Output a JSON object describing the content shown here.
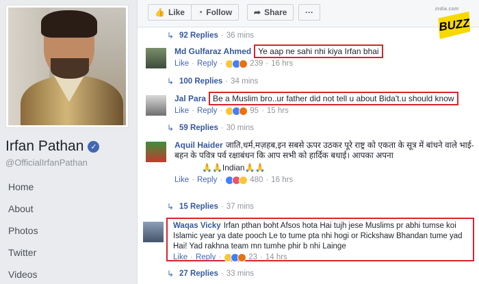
{
  "profile": {
    "name": "Irfan Pathan",
    "handle": "@OfficialIrfanPathan",
    "nav": [
      "Home",
      "About",
      "Photos",
      "Twitter",
      "Videos"
    ]
  },
  "actions": {
    "like": "Like",
    "follow": "Follow",
    "share": "Share",
    "more": "···"
  },
  "logo": {
    "site": "india.com",
    "name": "BUZZ"
  },
  "replies": [
    {
      "count": "92 Replies",
      "time": "36 mins"
    },
    {
      "count": "100 Replies",
      "time": "34 mins"
    },
    {
      "count": "59 Replies",
      "time": "30 mins"
    },
    {
      "count": "15 Replies",
      "time": "37 mins"
    },
    {
      "count": "27 Replies",
      "time": "33 mins"
    }
  ],
  "comments": [
    {
      "author": "Md Gulfaraz Ahmed",
      "text": "Ye aap ne sahi nhi kiya Irfan bhai",
      "like": "Like",
      "reply": "Reply",
      "reactions": "239",
      "time": "16 hrs"
    },
    {
      "author": "Jal Para",
      "text": "Be a Muslim bro..ur father did not tell u about Bida't.u should know",
      "like": "Like",
      "reply": "Reply",
      "reactions": "95",
      "time": "15 hrs"
    },
    {
      "author": "Aquil Haider",
      "text": "जाति,धर्म,मज़हब,इन सबसे ऊपर उठकर पूरे राष्ट्र को एकता के सूत्र में बांधने वाले भाई-बहन के पवित्र पर्व रक्षाबंधन कि आप सभी को हार्दिक बधाई। आपका अपना",
      "text2": "🙏🙏Indian🙏🙏",
      "like": "Like",
      "reply": "Reply",
      "reactions": "480",
      "time": "16 hrs"
    },
    {
      "author": "Waqas Vicky",
      "text": "Irfan pthan boht Afsos hota Hai tujh jese Muslims pr abhi tumse koi Islamic year ya date pooch Le to tume pta nhi hogi or Rickshaw Bhandan tume yad Hai! Yad rakhna team mn tumhe phir b nhi Lainge",
      "like": "Like",
      "reply": "Reply",
      "reactions": "23",
      "time": "14 hrs"
    }
  ]
}
